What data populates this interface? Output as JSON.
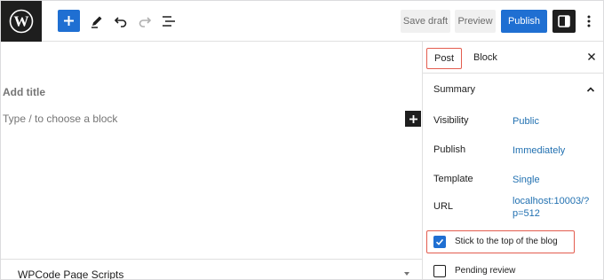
{
  "toolbar": {
    "save_draft_label": "Save draft",
    "preview_label": "Preview",
    "publish_label": "Publish",
    "accent_color": "#1f6fd2",
    "icons": [
      "wordpress-logo",
      "add-block-icon",
      "pencil-icon",
      "undo-icon",
      "redo-icon",
      "list-view-icon",
      "settings-icon",
      "more-options-icon"
    ]
  },
  "editor": {
    "title_placeholder": "Add title",
    "block_placeholder": "Type / to choose a block",
    "metabox_title": "WPCode Page Scripts"
  },
  "sidebar": {
    "tabs": [
      {
        "label": "Post",
        "active": true
      },
      {
        "label": "Block",
        "active": false
      }
    ],
    "summary_title": "Summary",
    "rows": [
      {
        "label": "Visibility",
        "value": "Public"
      },
      {
        "label": "Publish",
        "value": "Immediately"
      },
      {
        "label": "Template",
        "value": "Single"
      },
      {
        "label": "URL",
        "value_line1": "localhost:10003/?",
        "value_line2": "p=512"
      }
    ],
    "sticky": {
      "label": "Stick to the top of the blog",
      "checked": true
    },
    "pending": {
      "label": "Pending review",
      "checked": false
    },
    "highlight_color": "#e35d4f",
    "link_color": "#2271b1"
  }
}
